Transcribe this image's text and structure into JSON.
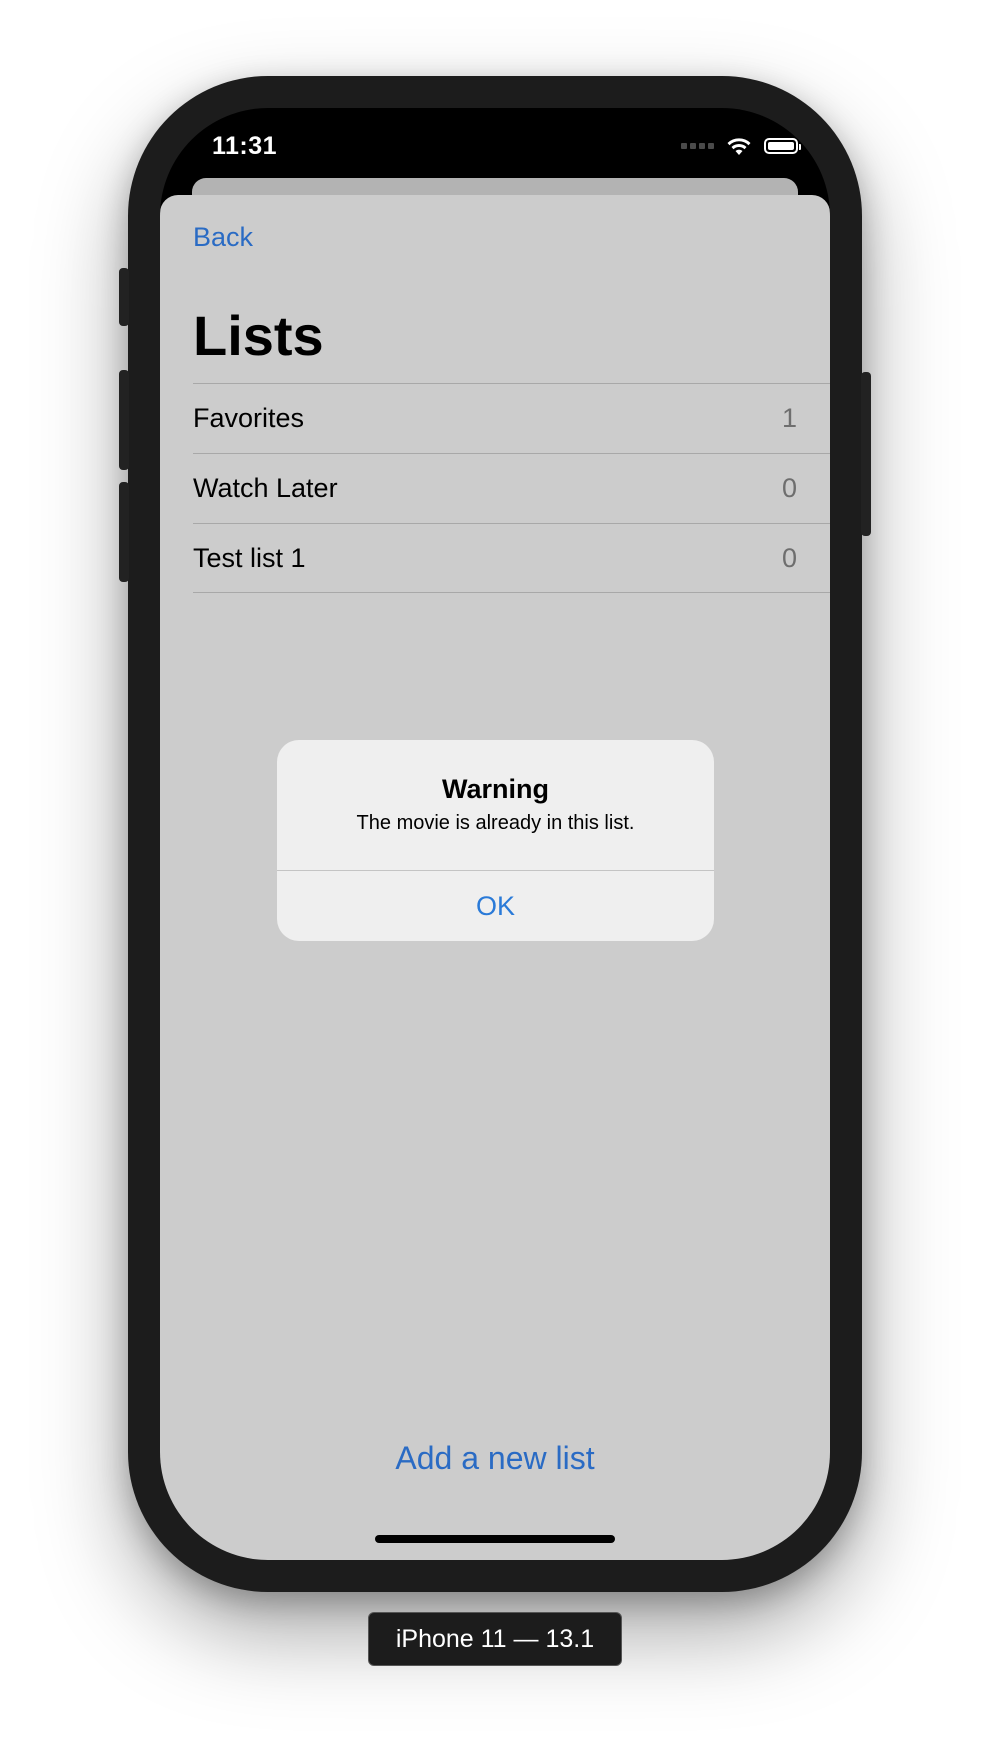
{
  "status_bar": {
    "time": "11:31",
    "icons": [
      "signal-dots-icon",
      "wifi-icon",
      "battery-icon"
    ]
  },
  "sheet": {
    "back_label": "Back",
    "title": "Lists",
    "lists": [
      {
        "label": "Favorites",
        "count": "1"
      },
      {
        "label": "Watch Later",
        "count": "0"
      },
      {
        "label": "Test list 1",
        "count": "0"
      }
    ],
    "add_list_label": "Add a new list"
  },
  "alert": {
    "title": "Warning",
    "message": "The movie is already in this list.",
    "ok_label": "OK"
  },
  "device_label": "iPhone 11 — 13.1",
  "colors": {
    "link": "#2a6bc4",
    "sheet_background": "#cccccc",
    "alert_background": "#efefef",
    "device_frame": "#1c1c1c"
  }
}
